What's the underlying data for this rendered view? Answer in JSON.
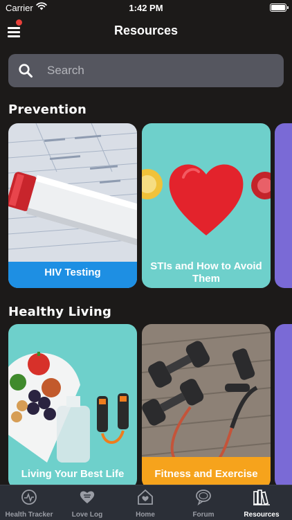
{
  "status_bar": {
    "carrier": "Carrier",
    "time": "1:42 PM"
  },
  "header": {
    "title": "Resources"
  },
  "search": {
    "placeholder": "Search"
  },
  "sections": [
    {
      "title": "Prevention",
      "cards": [
        {
          "label": "HIV Testing",
          "label_bg": "#1e8fe3"
        },
        {
          "label": "STIs and How to Avoid Them",
          "label_bg": "#6ed0cb"
        }
      ]
    },
    {
      "title": "Healthy Living",
      "cards": [
        {
          "label": "Living Your Best Life",
          "label_bg": "#6ed0cb"
        },
        {
          "label": "Fitness and Exercise",
          "label_bg": "#f6a31c"
        }
      ]
    }
  ],
  "tab_bar": {
    "tabs": [
      {
        "label": "Health Tracker",
        "icon": "heart-pulse-icon"
      },
      {
        "label": "Love Log",
        "icon": "heart-chat-icon"
      },
      {
        "label": "Home",
        "icon": "home-heart-icon"
      },
      {
        "label": "Forum",
        "icon": "chat-bubble-icon"
      },
      {
        "label": "Resources",
        "icon": "books-icon",
        "active": true
      }
    ]
  },
  "colors": {
    "background": "#1c1a19",
    "badge": "#e8403a",
    "search_bg": "#55565f",
    "tab_bar_bg": "#2b2f37",
    "peek_card": "#7a6ad6"
  }
}
